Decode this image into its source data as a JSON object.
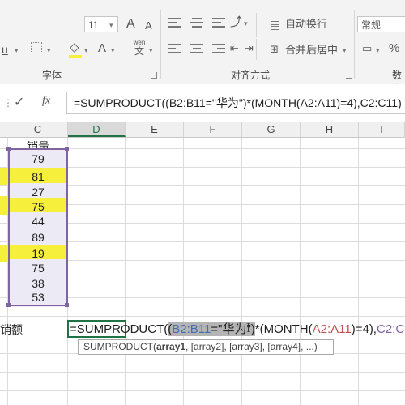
{
  "ribbon": {
    "font_size": "11",
    "font_grow_icon": "A",
    "font_shrink_icon": "A",
    "underline_label": "u",
    "font_color_label": "A",
    "wen_label": "wén",
    "wen_sub": "文",
    "wrap_text_label": "自动换行",
    "merge_center_label": "合并后居中",
    "number_format": "常规",
    "percent_label": "%",
    "group_font": "字体",
    "group_alignment": "对齐方式",
    "group_number": "数字"
  },
  "formula_bar": {
    "cancel_icon": "✓",
    "fx_label": "fx",
    "formula": "=SUMPRODUCT((B2:B11=\"华为\")*(MONTH(A2:A11)=4),C2:C11)"
  },
  "columns": [
    "C",
    "D",
    "E",
    "F",
    "G",
    "H",
    "I"
  ],
  "column_c": {
    "header": "销量",
    "values": [
      "79",
      "81",
      "27",
      "75",
      "44",
      "89",
      "19",
      "75",
      "38",
      "53"
    ],
    "highlighted": [
      false,
      true,
      false,
      true,
      false,
      false,
      true,
      false,
      false,
      false
    ]
  },
  "row12": {
    "left_label": "销额",
    "formula_parts": {
      "p1": "=SUMPRODUCT(",
      "p2": "(",
      "p3": "B2:B11",
      "p4": "=\"华为\"",
      "p5": ")",
      "p6": "*(",
      "p7": "MONTH(",
      "p8": "A2:A11",
      "p9": ")=4),",
      "p10": "C2:C11",
      "p11": ")"
    }
  },
  "tooltip": {
    "fn": "SUMPRODUCT(",
    "arg1": "array1",
    "rest": ", [array2], [array3], [array4], ...)"
  },
  "colors": {
    "highlight": "#f6f03c",
    "selection_border": "#8064a2",
    "range_blue": "#3f6fb5",
    "range_red": "#c0504d",
    "active_col_green": "#217346"
  }
}
